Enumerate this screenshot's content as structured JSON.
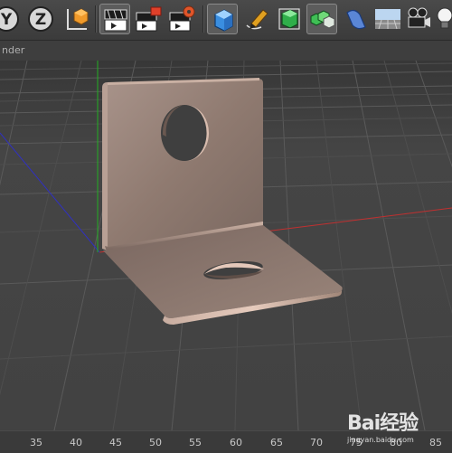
{
  "toolbar": {
    "axis_y_label": "Y",
    "axis_z_label": "Z",
    "buttons": [
      {
        "name": "axis-y-lock",
        "icon": "axis-y-icon"
      },
      {
        "name": "axis-z-lock",
        "icon": "axis-z-icon"
      },
      {
        "name": "coordinate-system",
        "icon": "coordinate-system-icon"
      },
      {
        "name": "render-view",
        "icon": "render-view-icon"
      },
      {
        "name": "render-to-picture-viewer",
        "icon": "render-picture-viewer-icon"
      },
      {
        "name": "render-settings",
        "icon": "render-settings-icon"
      },
      {
        "name": "cube-primitive",
        "icon": "cube-icon"
      },
      {
        "name": "pen-spline",
        "icon": "pen-icon"
      },
      {
        "name": "subdivision-generator",
        "icon": "subdivision-icon"
      },
      {
        "name": "array-generator",
        "icon": "array-icon"
      },
      {
        "name": "deformer",
        "icon": "deformer-icon"
      },
      {
        "name": "floor-environment",
        "icon": "floor-icon"
      },
      {
        "name": "camera",
        "icon": "camera-icon"
      },
      {
        "name": "light",
        "icon": "light-bulb-icon"
      }
    ]
  },
  "viewport": {
    "panel_title": "nder"
  },
  "timeline": {
    "ticks": [
      "35",
      "40",
      "45",
      "50",
      "55",
      "60",
      "65",
      "70",
      "75",
      "80",
      "85"
    ]
  },
  "watermark": {
    "logo_text": "Bai经验",
    "url": "jingyan.baidu.com"
  },
  "colors": {
    "viewport_bg": "#404040",
    "x_axis": "#c03030",
    "y_axis": "#22b022",
    "z_axis": "#3030c0",
    "metal_light": "#b89e8f",
    "metal_dark": "#5a4a42"
  }
}
